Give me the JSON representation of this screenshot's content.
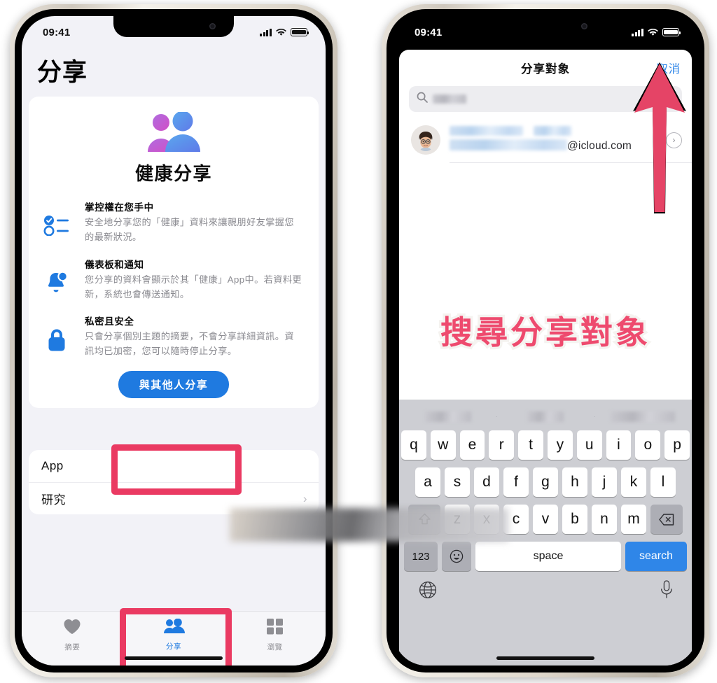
{
  "page": {
    "background": "#ffffff",
    "accent_blue": "#1f7ae0",
    "accent_pink": "#ea3a62",
    "annotation_color": "#ee4a6e"
  },
  "left_phone": {
    "status_bar": {
      "time": "09:41",
      "signal_icon": "cellular-bars-icon",
      "wifi_icon": "wifi-icon",
      "battery_icon": "battery-icon"
    },
    "page_title": "分享",
    "card": {
      "hero_icon": "two-people-icon",
      "hero_title": "健康分享",
      "features": [
        {
          "icon": "checklist-icon",
          "heading": "掌控權在您手中",
          "body": "安全地分享您的「健康」資料來讓親朋好友掌握您的最新狀況。"
        },
        {
          "icon": "bell-badge-icon",
          "heading": "儀表板和通知",
          "body": "您分享的資料會顯示於其「健康」App中。若資料更新，系統也會傳送通知。"
        },
        {
          "icon": "lock-icon",
          "heading": "私密且安全",
          "body": "只會分享個別主題的摘要，不會分享詳細資訊。資訊均已加密，您可以隨時停止分享。"
        }
      ],
      "share_button": "與其他人分享"
    },
    "list_rows": [
      {
        "label": "App",
        "chevron": ""
      },
      {
        "label": "研究",
        "chevron": "›"
      }
    ],
    "tabs": [
      {
        "label": "摘要",
        "icon": "heart-icon",
        "active": false
      },
      {
        "label": "分享",
        "icon": "two-people-icon",
        "active": true
      },
      {
        "label": "瀏覽",
        "icon": "grid-icon",
        "active": false
      }
    ]
  },
  "right_phone": {
    "status_bar": {
      "time": "09:41",
      "signal_icon": "cellular-bars-icon",
      "wifi_icon": "wifi-icon",
      "battery_icon": "battery-icon"
    },
    "sheet": {
      "title": "分享對象",
      "cancel_label": "取消",
      "search": {
        "icon": "search-icon",
        "value": "",
        "value_redacted": true,
        "clear_icon": "clear-circle-icon"
      },
      "contact": {
        "avatar_icon": "memoji-avatar",
        "name_redacted": true,
        "email_domain": "@icloud.com",
        "disclosure_icon": "chevron-right-circle-icon"
      }
    },
    "annotation": {
      "text": "搜尋分享對象",
      "arrow_icon": "up-arrow-annotation"
    },
    "keyboard": {
      "suggestions": [
        "",
        "",
        ""
      ],
      "suggestions_redacted": true,
      "row1": [
        "q",
        "w",
        "e",
        "r",
        "t",
        "y",
        "u",
        "i",
        "o",
        "p"
      ],
      "row2": [
        "a",
        "s",
        "d",
        "f",
        "g",
        "h",
        "j",
        "k",
        "l"
      ],
      "row3": [
        "z",
        "x",
        "c",
        "v",
        "b",
        "n",
        "m"
      ],
      "shift_icon": "shift-icon",
      "backspace_icon": "backspace-icon",
      "numbers_label": "123",
      "emoji_icon": "emoji-icon",
      "space_label": "space",
      "return_label": "search",
      "globe_icon": "globe-icon",
      "mic_icon": "microphone-icon"
    }
  }
}
